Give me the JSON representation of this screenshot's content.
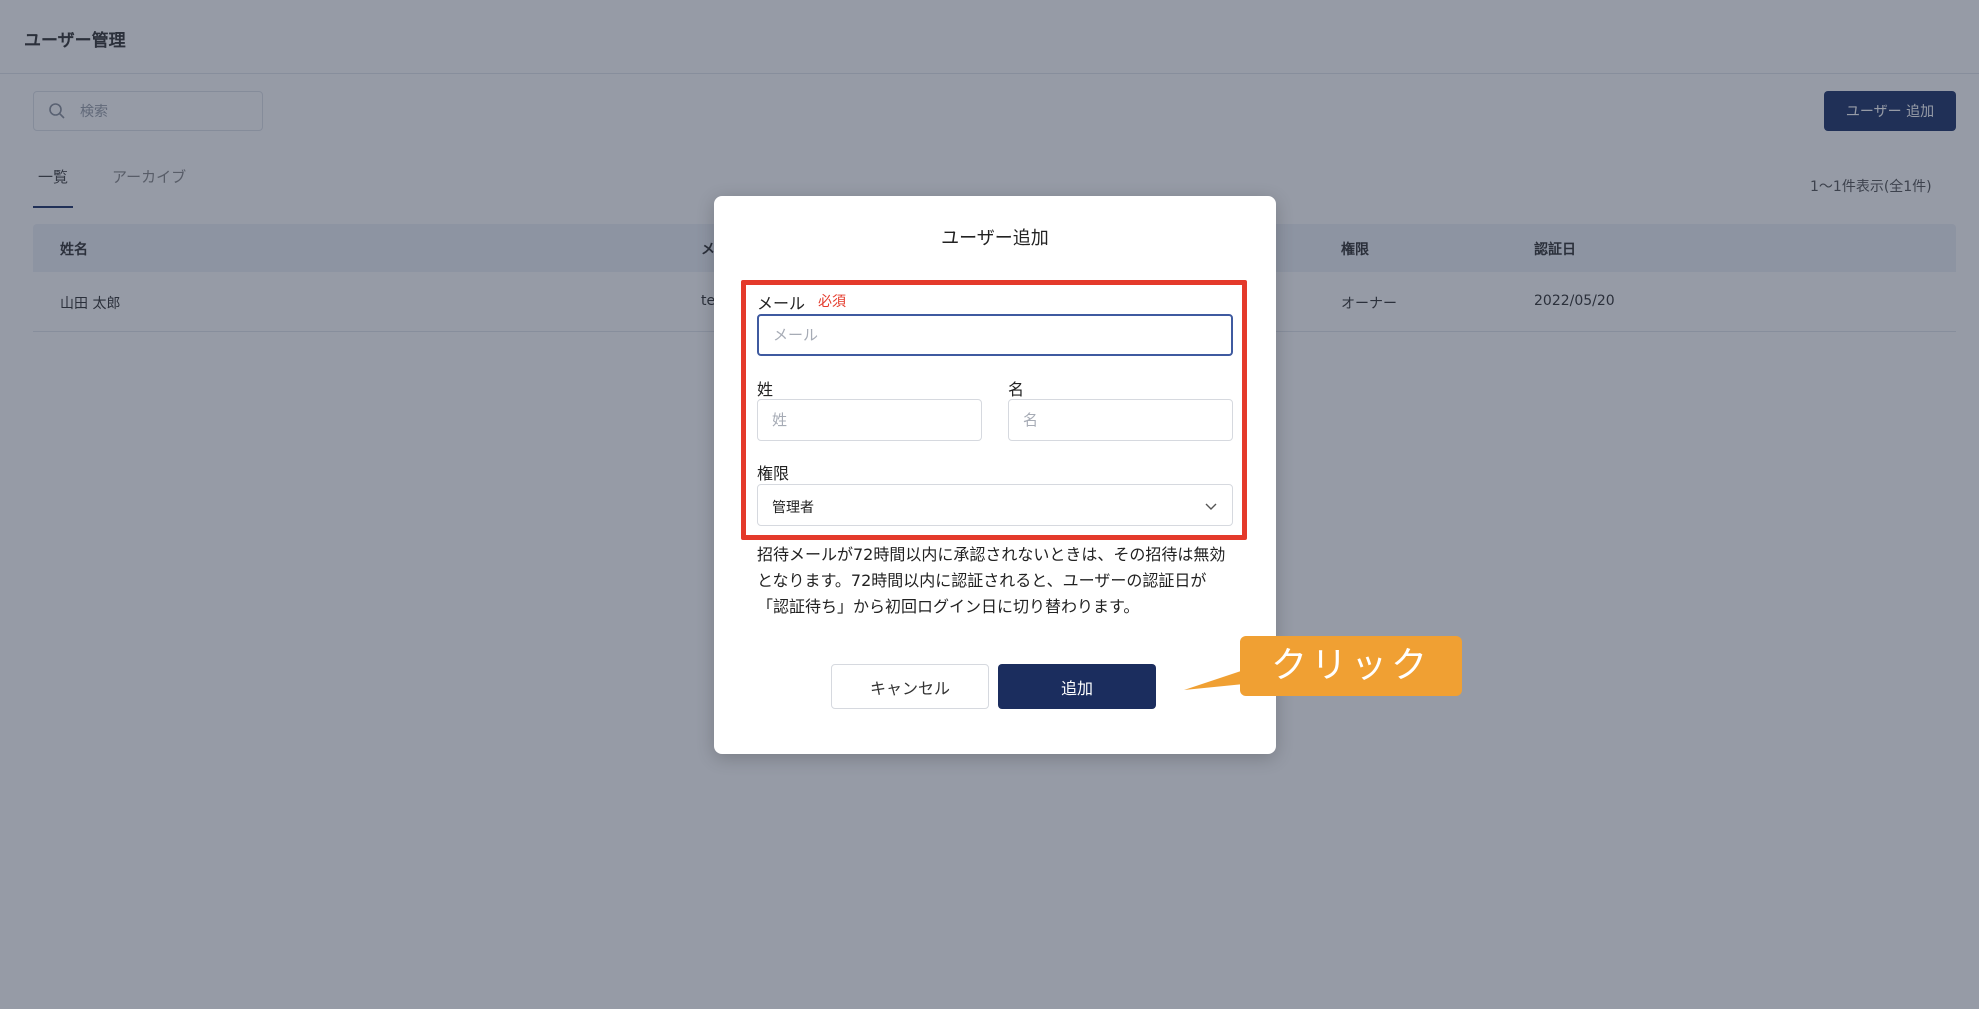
{
  "page": {
    "title": "ユーザー管理",
    "search_placeholder": "検索",
    "add_user_button": "ユーザー 追加",
    "tabs": [
      {
        "label": "一覧",
        "active": true
      },
      {
        "label": "アーカイブ",
        "active": false
      }
    ],
    "count_label": "1～1件表示(全1件)",
    "table": {
      "columns": [
        "姓名",
        "メ",
        "権限",
        "認証日"
      ],
      "rows": [
        {
          "name": "山田 太郎",
          "email_fragment": "te",
          "role": "オーナー",
          "verified_date": "2022/05/20"
        }
      ]
    }
  },
  "modal": {
    "title": "ユーザー追加",
    "email": {
      "label": "メール",
      "required": "必須",
      "placeholder": "メール",
      "value": ""
    },
    "last_name": {
      "label": "姓",
      "placeholder": "姓",
      "value": ""
    },
    "first_name": {
      "label": "名",
      "placeholder": "名",
      "value": ""
    },
    "role": {
      "label": "権限",
      "selected": "管理者"
    },
    "note": "招待メールが72時間以内に承認されないときは、その招待は無効となります。72時間以内に認証されると、ユーザーの認証日が「認証待ち」から初回ログイン日に切り替わります。",
    "cancel_button": "キャンセル",
    "submit_button": "追加"
  },
  "callout": {
    "text": "クリック"
  },
  "colors": {
    "brand": "#1b2d5e",
    "highlight_border": "#e43a2b",
    "callout": "#f0a033",
    "required": "#e43a2b"
  },
  "icons": [
    "search-icon",
    "chevron-down-icon"
  ]
}
